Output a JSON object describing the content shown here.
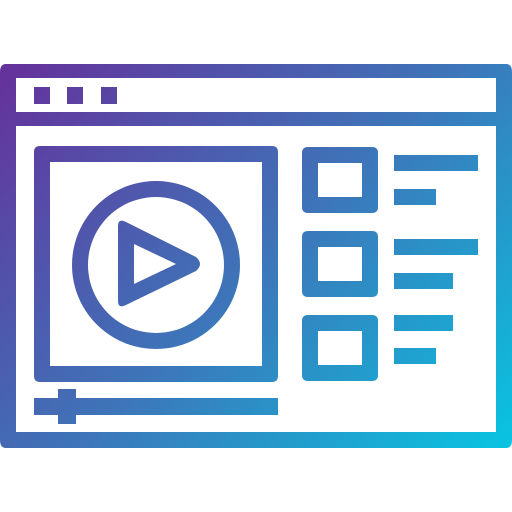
{
  "icon": {
    "name": "video-player-window-icon",
    "gradient": {
      "start": "#6b2796",
      "mid": "#3f73b8",
      "end": "#00d0e6"
    },
    "background": "#ffffff"
  },
  "window": {
    "controls": [
      "window-dot",
      "window-dot",
      "window-dot"
    ]
  },
  "player": {
    "play_icon": "play-icon",
    "progress": 0.12
  },
  "playlist": {
    "items": [
      {
        "name": "playlist-item-1"
      },
      {
        "name": "playlist-item-2"
      },
      {
        "name": "playlist-item-3"
      }
    ]
  }
}
